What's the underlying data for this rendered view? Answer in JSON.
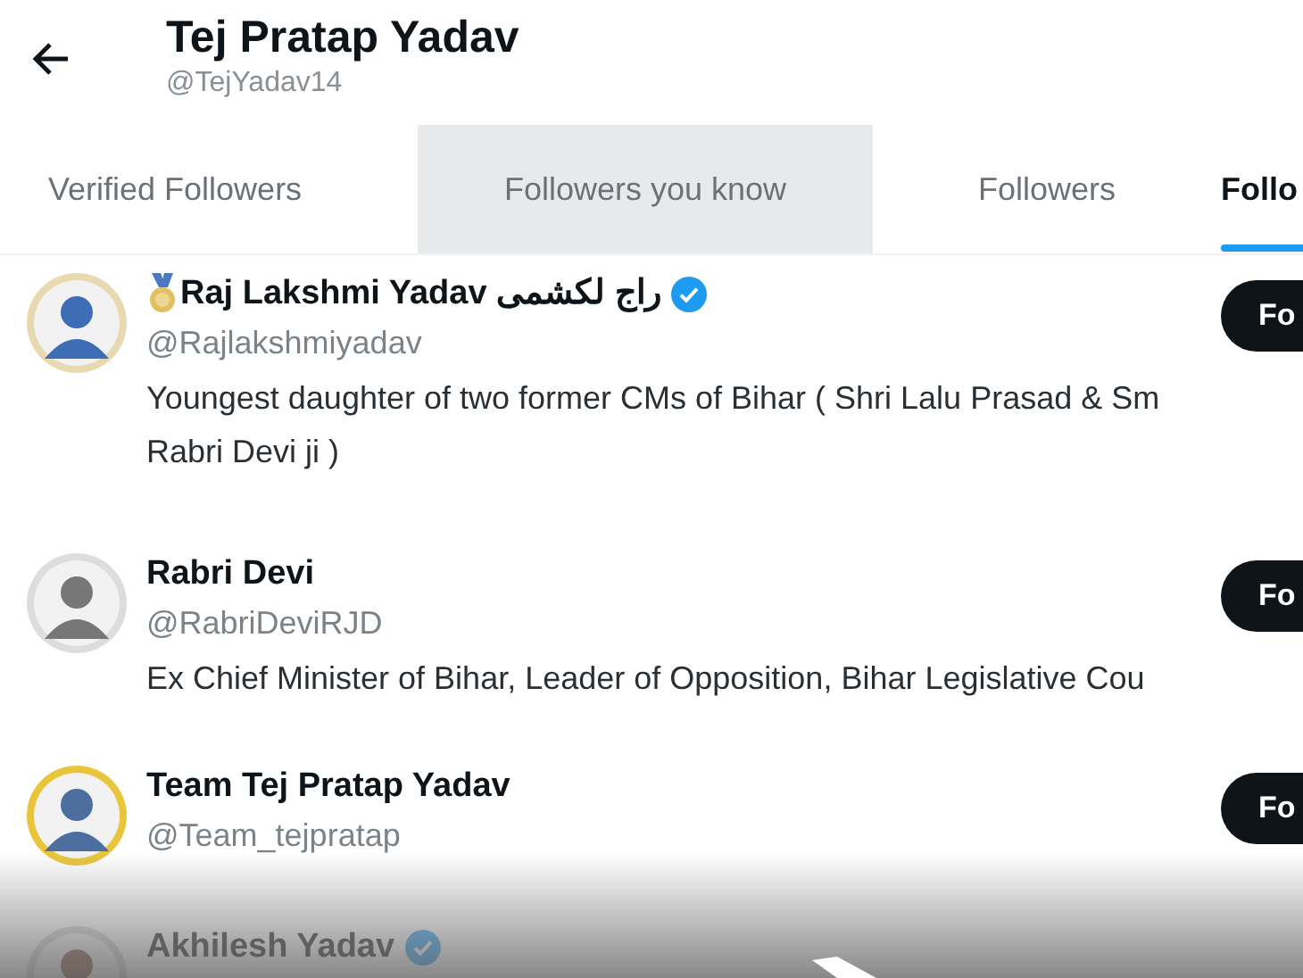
{
  "header": {
    "title": "Tej Pratap Yadav",
    "handle": "@TejYadav14"
  },
  "tabs": [
    {
      "label": "Verified Followers",
      "selected": false,
      "pressed": false
    },
    {
      "label": "Followers you know",
      "selected": false,
      "pressed": true
    },
    {
      "label": "Followers",
      "selected": false,
      "pressed": false
    },
    {
      "label": "Follo",
      "selected": true,
      "pressed": false
    }
  ],
  "users": [
    {
      "medal": true,
      "name": "Raj Lakshmi Yadav راج لکشمی",
      "verified": true,
      "handle": "@Rajlakshmiyadav",
      "bio": [
        "Youngest daughter of two former CMs of Bihar ( Shri Lalu Prasad & Sm",
        "Rabri Devi ji )"
      ],
      "button": "Fo"
    },
    {
      "medal": false,
      "name": "Rabri Devi",
      "verified": false,
      "handle": "@RabriDeviRJD",
      "bio": [
        "Ex Chief Minister of Bihar, Leader of Opposition, Bihar Legislative Cou"
      ],
      "button": "Fo"
    },
    {
      "medal": false,
      "name": "Team Tej Pratap Yadav",
      "verified": false,
      "handle": "@Team_tejpratap",
      "button": "Fo"
    },
    {
      "medal": false,
      "name": "Akhilesh Yadav",
      "verified": true
    }
  ]
}
